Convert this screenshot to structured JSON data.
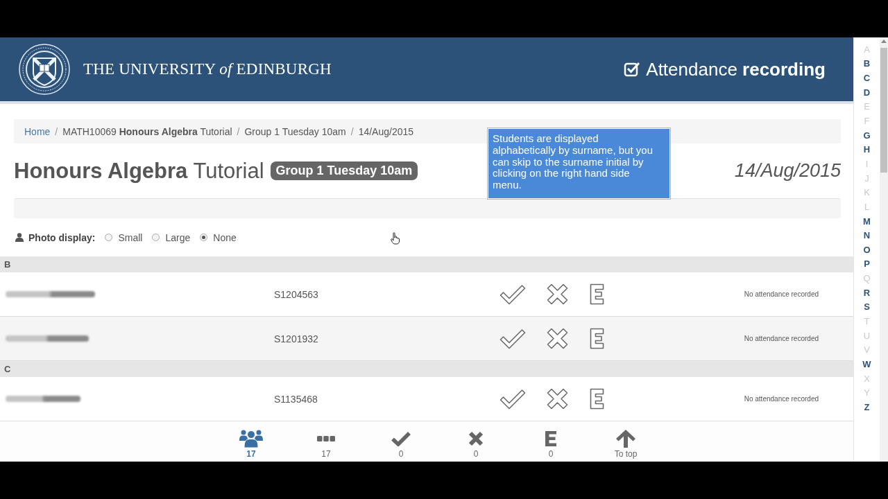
{
  "header": {
    "logo_text": "THE UNIVERSITY *of* EDINBURGH",
    "app_title": "Attendance **recording**"
  },
  "breadcrumb": {
    "separator": "/",
    "items": [
      {
        "text": "Home",
        "link": true
      },
      {
        "text": "MATH10069 **Honours Algebra** Tutorial",
        "link": false
      },
      {
        "text": "Group 1 Tuesday 10am",
        "link": false
      },
      {
        "text": "14/Aug/2015",
        "link": false
      }
    ]
  },
  "page_title": {
    "title": "**Honours Algebra** Tutorial",
    "badge": "Group 1 Tuesday 10am",
    "date": "14/Aug/2015"
  },
  "tooltip": "Students are displayed alphabetically by surname, but you can skip to the surname initial by clicking on the right hand side menu.",
  "photo_display": {
    "label": "Photo display:",
    "options": [
      {
        "label": "Small",
        "selected": false
      },
      {
        "label": "Large",
        "selected": false
      },
      {
        "label": "None",
        "selected": true
      }
    ]
  },
  "sections": [
    {
      "letter": "B",
      "students": [
        {
          "id": "S1204563",
          "status": "No attendance recorded"
        },
        {
          "id": "S1201932",
          "status": "No attendance recorded"
        }
      ]
    },
    {
      "letter": "C",
      "students": [
        {
          "id": "S1135468",
          "status": "No attendance recorded"
        }
      ]
    }
  ],
  "bottom_bar": [
    {
      "kind": "students",
      "count": "17",
      "selected": true
    },
    {
      "kind": "unrecorded",
      "count": "17",
      "selected": false
    },
    {
      "kind": "present",
      "count": "0",
      "selected": false
    },
    {
      "kind": "absent",
      "count": "0",
      "selected": false
    },
    {
      "kind": "excused",
      "count": "0",
      "selected": false
    },
    {
      "kind": "top",
      "label": "To top",
      "selected": false
    }
  ],
  "alphabet": [
    {
      "letter": "A",
      "enabled": false
    },
    {
      "letter": "B",
      "enabled": true
    },
    {
      "letter": "C",
      "enabled": true
    },
    {
      "letter": "D",
      "enabled": true
    },
    {
      "letter": "E",
      "enabled": false
    },
    {
      "letter": "F",
      "enabled": false
    },
    {
      "letter": "G",
      "enabled": true
    },
    {
      "letter": "H",
      "enabled": true
    },
    {
      "letter": "I",
      "enabled": false
    },
    {
      "letter": "J",
      "enabled": false
    },
    {
      "letter": "K",
      "enabled": false
    },
    {
      "letter": "L",
      "enabled": false
    },
    {
      "letter": "M",
      "enabled": true
    },
    {
      "letter": "N",
      "enabled": true
    },
    {
      "letter": "O",
      "enabled": true
    },
    {
      "letter": "P",
      "enabled": true
    },
    {
      "letter": "Q",
      "enabled": false
    },
    {
      "letter": "R",
      "enabled": true
    },
    {
      "letter": "S",
      "enabled": true
    },
    {
      "letter": "T",
      "enabled": false
    },
    {
      "letter": "U",
      "enabled": false
    },
    {
      "letter": "V",
      "enabled": false
    },
    {
      "letter": "W",
      "enabled": true
    },
    {
      "letter": "X",
      "enabled": false
    },
    {
      "letter": "Y",
      "enabled": false
    },
    {
      "letter": "Z",
      "enabled": true
    }
  ]
}
